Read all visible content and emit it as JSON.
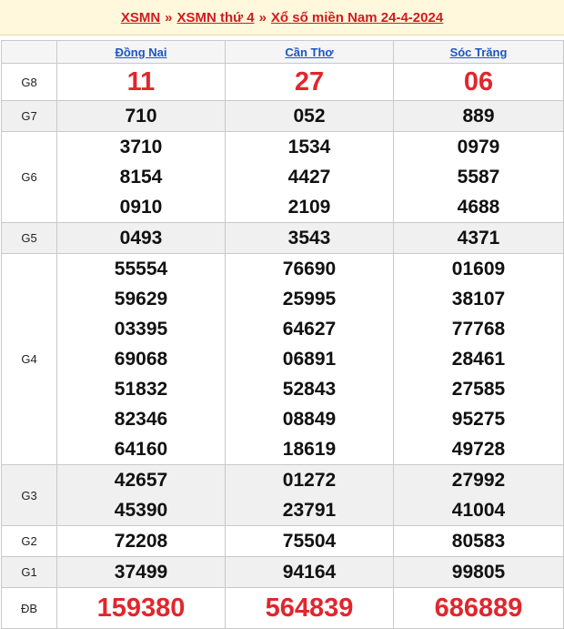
{
  "breadcrumb": {
    "link1": "XSMN",
    "sep1": "»",
    "link2": "XSMN thứ 4",
    "sep2": "»",
    "link3": "Xổ số miền Nam 24-4-2024"
  },
  "provinces": [
    "Đồng Nai",
    "Cần Thơ",
    "Sóc Trăng"
  ],
  "prizes": {
    "g8": {
      "label": "G8",
      "values": [
        [
          "11"
        ],
        [
          "27"
        ],
        [
          "06"
        ]
      ]
    },
    "g7": {
      "label": "G7",
      "values": [
        [
          "710"
        ],
        [
          "052"
        ],
        [
          "889"
        ]
      ]
    },
    "g6": {
      "label": "G6",
      "values": [
        [
          "3710",
          "8154",
          "0910"
        ],
        [
          "1534",
          "4427",
          "2109"
        ],
        [
          "0979",
          "5587",
          "4688"
        ]
      ]
    },
    "g5": {
      "label": "G5",
      "values": [
        [
          "0493"
        ],
        [
          "3543"
        ],
        [
          "4371"
        ]
      ]
    },
    "g4": {
      "label": "G4",
      "values": [
        [
          "55554",
          "59629",
          "03395",
          "69068",
          "51832",
          "82346",
          "64160"
        ],
        [
          "76690",
          "25995",
          "64627",
          "06891",
          "52843",
          "08849",
          "18619"
        ],
        [
          "01609",
          "38107",
          "77768",
          "28461",
          "27585",
          "95275",
          "49728"
        ]
      ]
    },
    "g3": {
      "label": "G3",
      "values": [
        [
          "42657",
          "45390"
        ],
        [
          "01272",
          "23791"
        ],
        [
          "27992",
          "41004"
        ]
      ]
    },
    "g2": {
      "label": "G2",
      "values": [
        [
          "72208"
        ],
        [
          "75504"
        ],
        [
          "80583"
        ]
      ]
    },
    "g1": {
      "label": "G1",
      "values": [
        [
          "37499"
        ],
        [
          "94164"
        ],
        [
          "99805"
        ]
      ]
    },
    "db": {
      "label": "ĐB",
      "values": [
        [
          "159380"
        ],
        [
          "564839"
        ],
        [
          "686889"
        ]
      ]
    }
  }
}
